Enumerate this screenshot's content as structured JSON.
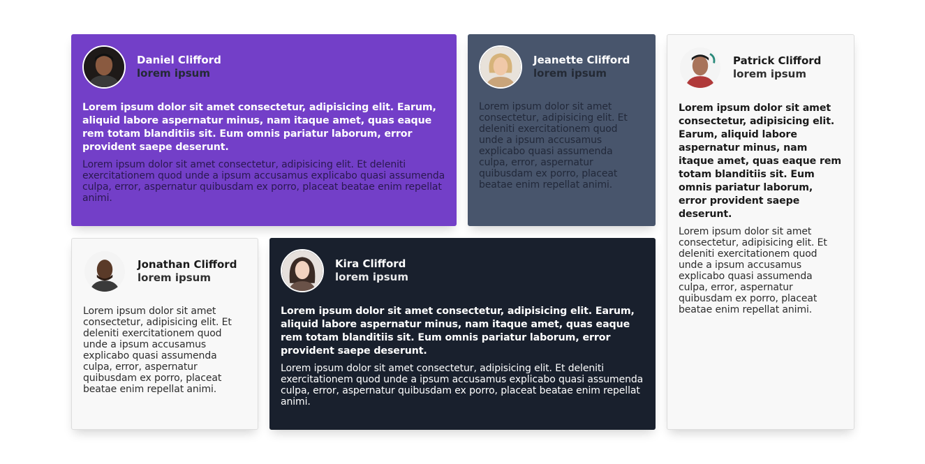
{
  "colors": {
    "purple": "#733fc8",
    "slate": "#48556c",
    "light": "#f8f8f8",
    "dark": "#19202d"
  },
  "cards": [
    {
      "name": "Daniel Clifford",
      "role": "lorem ipsum",
      "quote": "Lorem ipsum dolor sit amet consectetur, adipisicing elit. Earum, aliquid labore aspernatur minus, nam itaque amet, quas eaque rem totam blanditiis sit. Eum omnis pariatur laborum, error provident saepe deserunt.",
      "body": "Lorem ipsum dolor sit amet consectetur, adipisicing elit. Et deleniti exercitationem quod unde a ipsum accusamus explicabo quasi assumenda culpa, error, aspernatur quibusdam ex porro, placeat beatae enim repellat animi."
    },
    {
      "name": "Jeanette Clifford",
      "role": "lorem ipsum",
      "body": "Lorem ipsum dolor sit amet consectetur, adipisicing elit. Et deleniti exercitationem quod unde a ipsum accusamus explicabo quasi assumenda culpa, error, aspernatur quibusdam ex porro, placeat beatae enim repellat animi."
    },
    {
      "name": "Patrick Clifford",
      "role": "lorem ipsum",
      "quote": "Lorem ipsum dolor sit amet consectetur, adipisicing elit. Earum, aliquid labore aspernatur minus, nam itaque amet, quas eaque rem totam blanditiis sit. Eum omnis pariatur laborum, error provident saepe deserunt.",
      "body": "Lorem ipsum dolor sit amet consectetur, adipisicing elit. Et deleniti exercitationem quod unde a ipsum accusamus explicabo quasi assumenda culpa, error, aspernatur quibusdam ex porro, placeat beatae enim repellat animi."
    },
    {
      "name": "Jonathan Clifford",
      "role": "lorem ipsum",
      "body": "Lorem ipsum dolor sit amet consectetur, adipisicing elit. Et deleniti exercitationem quod unde a ipsum accusamus explicabo quasi assumenda culpa, error, aspernatur quibusdam ex porro, placeat beatae enim repellat animi."
    },
    {
      "name": "Kira Clifford",
      "role": "lorem ipsum",
      "quote": "Lorem ipsum dolor sit amet consectetur, adipisicing elit. Earum, aliquid labore aspernatur minus, nam itaque amet, quas eaque rem totam blanditiis sit. Eum omnis pariatur laborum, error provident saepe deserunt.",
      "body": "Lorem ipsum dolor sit amet consectetur, adipisicing elit. Et deleniti exercitationem quod unde a ipsum accusamus explicabo quasi assumenda culpa, error, aspernatur quibusdam ex porro, placeat beatae enim repellat animi."
    }
  ]
}
